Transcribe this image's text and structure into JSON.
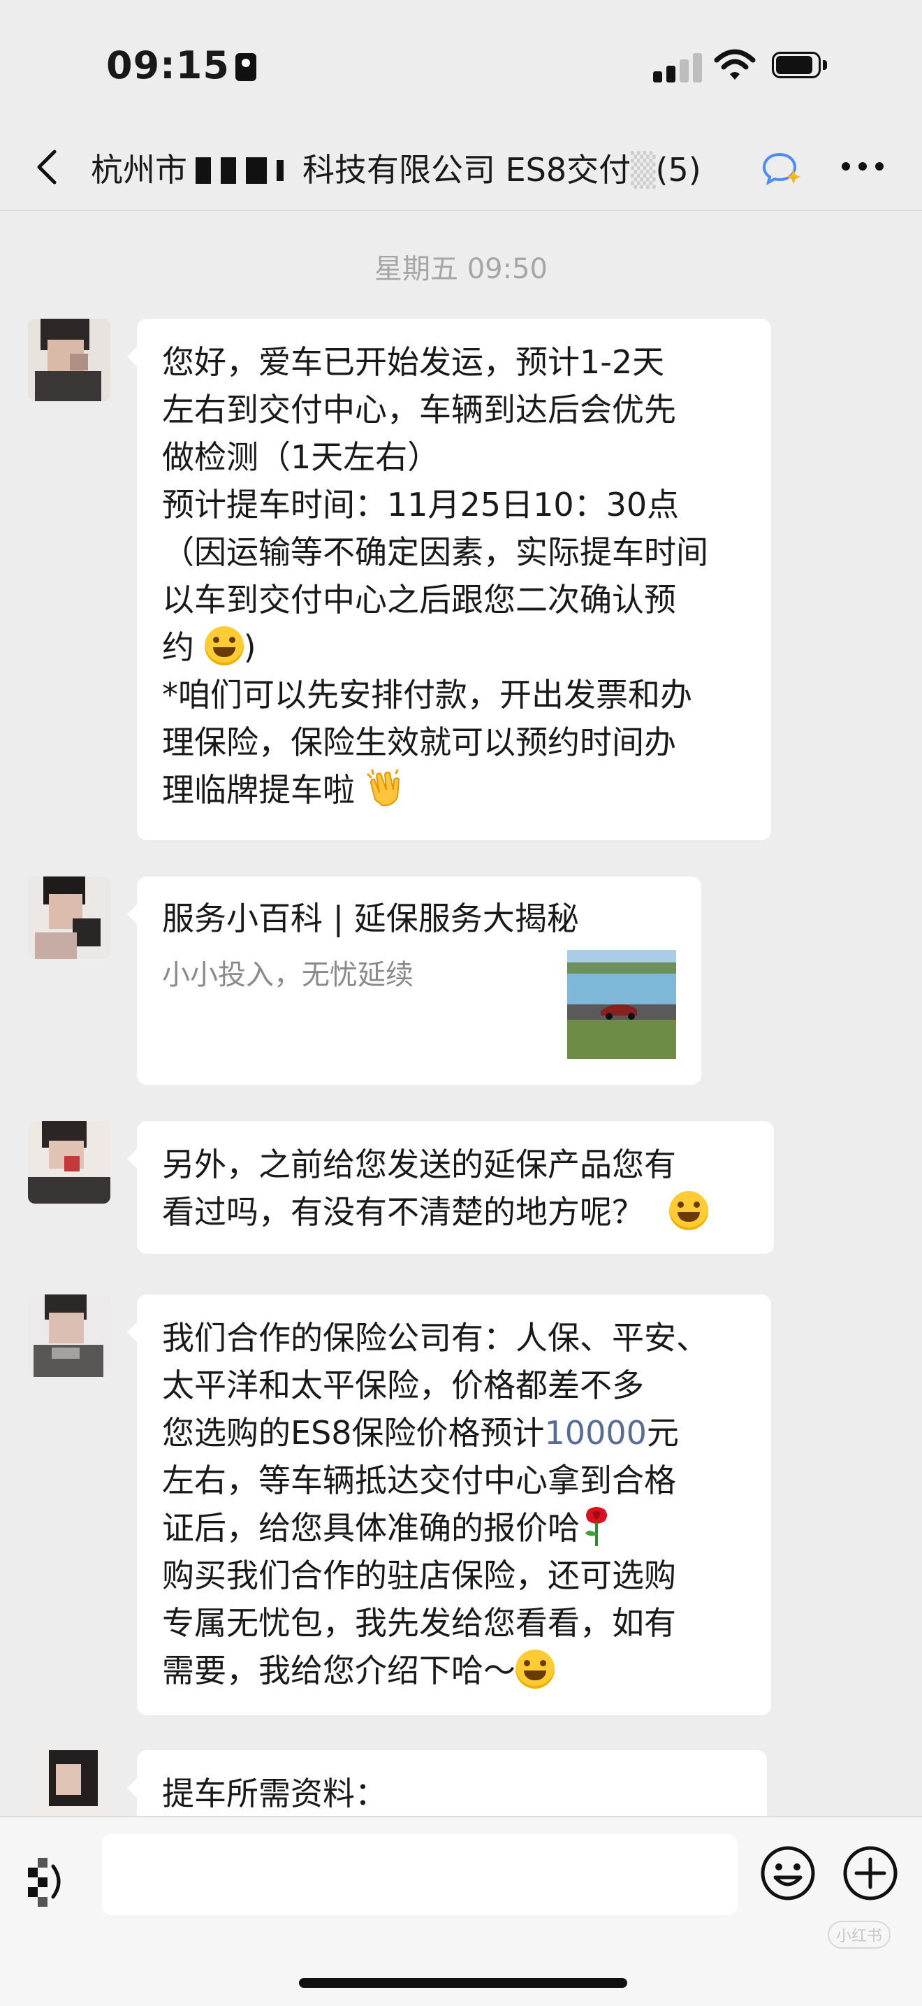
{
  "status_bar": {
    "time": "09:15",
    "icons": [
      "id-card-icon",
      "signal-icon",
      "wifi-icon",
      "battery-icon"
    ]
  },
  "nav": {
    "title_part1": "杭州市",
    "title_part2": "科技有限公司 ES8交付",
    "member_count": "(5)",
    "back_icon": "chevron-left-icon",
    "more_icon": "more-icon"
  },
  "chat": {
    "timestamp": "星期五 09:50",
    "messages": [
      {
        "lines": [
          "您好，爱车已开始发运，预计1-2天",
          "左右到交付中心，车辆到达后会优先",
          "做检测（1天左右）",
          "预计提车时间：11月25日10：30点",
          "（因运输等不确定因素，实际提车时间",
          "以车到交付中心之后跟您二次确认预",
          "约",
          ")",
          "*咱们可以先安排付款，开出发票和办",
          "理保险，保险生效就可以预约时间办",
          "理临牌提车啦"
        ]
      },
      {
        "card_title": "服务小百科 | 延保服务大揭秘",
        "card_desc": "小小投入，无忧延续"
      },
      {
        "lines": [
          "另外，之前给您发送的延保产品您有",
          "看过吗，有没有不清楚的地方呢？"
        ]
      },
      {
        "lines": [
          "我们合作的保险公司有：人保、平安、",
          "太平洋和太平保险，价格都差不多",
          "您选购的ES8保险价格预计",
          "10000",
          "元",
          "左右，等车辆抵达交付中心拿到合格",
          "证后，给您具体准确的报价哈",
          "购买我们合作的驻店保险，还可选购",
          "专属无忧包，我先发给您看看，如有",
          "需要，我给您介绍下哈～"
        ]
      },
      {
        "lines": [
          "提车所需资料："
        ]
      }
    ]
  },
  "input_bar": {
    "voice_icon": "voice-icon",
    "emoji_icon": "emoji-icon",
    "plus_icon": "plus-icon",
    "watermark": "小红书"
  },
  "colors": {
    "background": "#ededed",
    "bubble": "#ffffff",
    "link": "#576b95",
    "timestamp": "#a6a6a6"
  }
}
